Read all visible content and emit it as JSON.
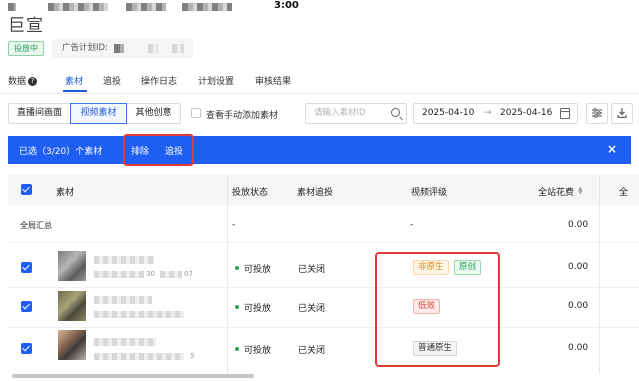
{
  "status_bar": {
    "time": "3:00"
  },
  "brand": {
    "name": "巨宣"
  },
  "campaign": {
    "status_badge": "投放中",
    "plan_id_label": "广告计划ID:"
  },
  "tabs": [
    {
      "label": "数据",
      "active": false
    },
    {
      "label": "素材",
      "active": true
    },
    {
      "label": "追投",
      "active": false
    },
    {
      "label": "操作日志",
      "active": false
    },
    {
      "label": "计划设置",
      "active": false
    },
    {
      "label": "审核结果",
      "active": false
    }
  ],
  "toolbar": {
    "segments": [
      {
        "label": "直播间画面",
        "active": false
      },
      {
        "label": "视频素材",
        "active": true
      },
      {
        "label": "其他创意",
        "active": false
      }
    ],
    "manual_checkbox_label": "查看手动添加素材",
    "search_placeholder": "请输入素材ID",
    "date_start": "2025-04-10",
    "date_arrow": "→",
    "date_end": "2025-04-16"
  },
  "selection_bar": {
    "text": "已选（3/20）个素材",
    "actions": [
      "排除",
      "追投"
    ],
    "close": "×"
  },
  "table": {
    "headers": [
      "素材",
      "投放状态",
      "素材追投",
      "视频评级",
      "全站花费",
      "全"
    ],
    "summary": {
      "label": "全局汇总",
      "status": "-",
      "rating": "-",
      "cost": "0.00"
    },
    "rows": [
      {
        "checked": true,
        "id_fragment": "30",
        "date_fragment": "07",
        "status": "可投放",
        "boost": "已关闭",
        "tags": [
          {
            "text": "非原生",
            "style": "orange"
          },
          {
            "text": "原创",
            "style": "green"
          }
        ],
        "cost": "0.00"
      },
      {
        "checked": true,
        "id_fragment": "",
        "date_fragment": "",
        "status": "可投放",
        "boost": "已关闭",
        "tags": [
          {
            "text": "低效",
            "style": "red"
          }
        ],
        "cost": "0.00"
      },
      {
        "checked": true,
        "id_fragment": "",
        "date_fragment": "5",
        "status": "可投放",
        "boost": "已关闭",
        "tags": [
          {
            "text": "普通原生",
            "style": "gray"
          }
        ],
        "cost": "0.00"
      }
    ]
  },
  "colors": {
    "primary": "#1f5ef2",
    "highlight": "#e53935",
    "success": "#27a25a"
  }
}
